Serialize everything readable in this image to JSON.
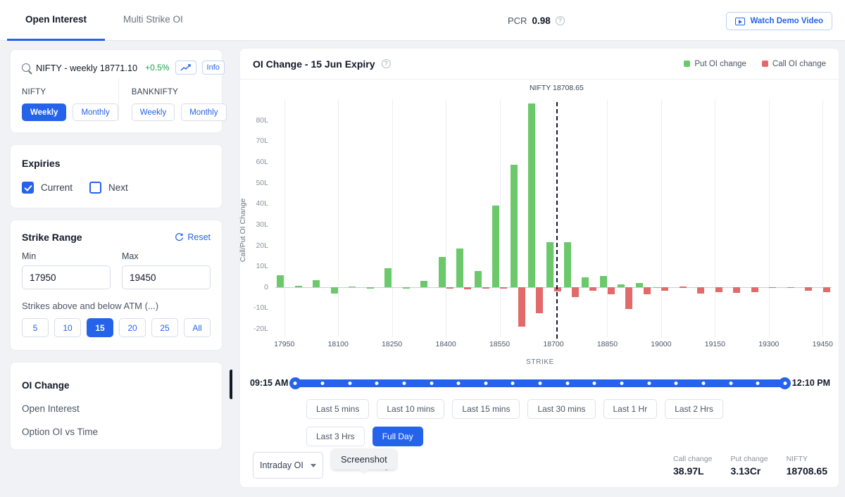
{
  "topbar": {
    "tabs": [
      {
        "label": "Open Interest",
        "active": true
      },
      {
        "label": "Multi Strike OI",
        "active": false
      }
    ],
    "pcr_label": "PCR",
    "pcr_value": "0.98",
    "help_icon": "question-mark-icon",
    "demo_button": "Watch Demo Video",
    "demo_icon": "video-icon"
  },
  "sidebar": {
    "search": {
      "icon": "search-icon",
      "symbol": "NIFTY - weekly 18771.10",
      "change_pct": "+0.5%",
      "chart_icon": "trendline-icon",
      "info_button": "Info"
    },
    "index_groups": [
      {
        "name": "NIFTY",
        "options": [
          {
            "label": "Weekly",
            "selected": true
          },
          {
            "label": "Monthly",
            "selected": false
          }
        ]
      },
      {
        "name": "BANKNIFTY",
        "options": [
          {
            "label": "Weekly",
            "selected": false
          },
          {
            "label": "Monthly",
            "selected": false
          }
        ]
      }
    ],
    "expiries": {
      "title": "Expiries",
      "options": [
        {
          "label": "Current",
          "checked": true
        },
        {
          "label": "Next",
          "checked": false
        }
      ]
    },
    "strike_range": {
      "title": "Strike Range",
      "reset_label": "Reset",
      "reset_icon": "refresh-icon",
      "min_label": "Min",
      "max_label": "Max",
      "min_value": "17950",
      "max_value": "19450",
      "atm_label": "Strikes above and below ATM (...)",
      "counts": [
        {
          "label": "5",
          "selected": false
        },
        {
          "label": "10",
          "selected": false
        },
        {
          "label": "15",
          "selected": true
        },
        {
          "label": "20",
          "selected": false
        },
        {
          "label": "25",
          "selected": false
        },
        {
          "label": "All",
          "selected": false
        }
      ]
    },
    "menu": [
      {
        "label": "OI Change",
        "active": true
      },
      {
        "label": "Open Interest",
        "active": false
      },
      {
        "label": "Option OI vs Time",
        "active": false
      }
    ]
  },
  "panel": {
    "title": "OI Change - 15 Jun Expiry",
    "help_icon": "question-mark-icon",
    "legend": [
      {
        "label": "Put OI change",
        "color": "#6BC96B"
      },
      {
        "label": "Call OI change",
        "color": "#E26A6A"
      }
    ],
    "slider": {
      "start": "09:15 AM",
      "end": "12:10 PM"
    },
    "ranges": [
      [
        {
          "label": "Last 5 mins",
          "selected": false
        },
        {
          "label": "Last 10 mins",
          "selected": false
        },
        {
          "label": "Last 15 mins",
          "selected": false
        },
        {
          "label": "Last 30 mins",
          "selected": false
        },
        {
          "label": "Last 1 Hr",
          "selected": false
        },
        {
          "label": "Last 2 Hrs",
          "selected": false
        }
      ],
      [
        {
          "label": "Last 3 Hrs",
          "selected": false
        },
        {
          "label": "Full Day",
          "selected": true
        }
      ]
    ],
    "footer": {
      "select_value": "Intraday OI",
      "note": "date OI Change",
      "tooltip": "Screenshot",
      "stats": [
        {
          "key": "Call change",
          "value": "38.97L"
        },
        {
          "key": "Put change",
          "value": "3.13Cr"
        },
        {
          "key": "NIFTY",
          "value": "18708.65"
        }
      ]
    }
  },
  "chart_data": {
    "type": "bar",
    "title": "OI Change - 15 Jun Expiry",
    "xlabel": "STRIKE",
    "ylabel": "Call/Put OI Change",
    "ylim": [
      -22,
      90
    ],
    "yticks": [
      80,
      70,
      60,
      50,
      40,
      30,
      20,
      10,
      0,
      -10,
      -20
    ],
    "ytick_labels": [
      "80L",
      "70L",
      "60L",
      "50L",
      "40L",
      "30L",
      "20L",
      "10L",
      "0",
      "-10L",
      "-20L"
    ],
    "xtick_labels": [
      "17950",
      "18100",
      "18250",
      "18400",
      "18550",
      "18700",
      "18850",
      "19000",
      "19150",
      "19300",
      "19450"
    ],
    "grid": true,
    "legend_position": "top-right",
    "unit": "L",
    "annotation": {
      "label": "NIFTY 18708.65",
      "x_strike": 18708.65,
      "style": "dashed-vertical"
    },
    "categories": [
      17950,
      18000,
      18050,
      18100,
      18150,
      18200,
      18250,
      18300,
      18350,
      18400,
      18450,
      18500,
      18550,
      18600,
      18650,
      18700,
      18750,
      18800,
      18850,
      18900,
      18950,
      19000,
      19050,
      19100,
      19150,
      19200,
      19250,
      19300,
      19350,
      19400,
      19450
    ],
    "series": [
      {
        "name": "Put OI change",
        "color": "#6BC96B",
        "values": [
          5.8,
          0.5,
          3.4,
          -3.0,
          0.3,
          -0.9,
          9.0,
          -0.7,
          2.8,
          14.5,
          18.5,
          7.6,
          39.0,
          58.5,
          88.0,
          21.5,
          21.5,
          4.5,
          5.2,
          1.2,
          1.8,
          -0.2,
          0,
          0,
          0,
          0,
          0,
          0,
          0,
          0,
          0
        ]
      },
      {
        "name": "Call OI change",
        "color": "#E26A6A",
        "values": [
          0,
          0,
          0,
          0,
          0,
          0,
          0,
          0,
          0,
          -0.8,
          -1.0,
          -0.8,
          -0.9,
          -19.0,
          -12.5,
          -2.2,
          -4.8,
          -1.8,
          -3.4,
          -10.5,
          -3.5,
          -1.7,
          0.1,
          -3.2,
          -2.4,
          -2.9,
          -2.6,
          -0.4,
          -0.1,
          -1.9,
          -2.6
        ]
      }
    ]
  }
}
